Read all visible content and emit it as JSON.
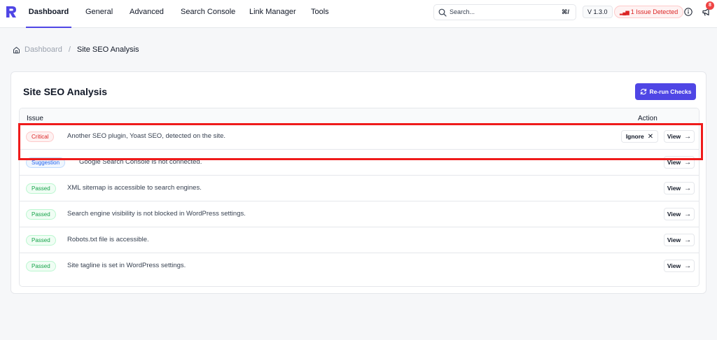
{
  "nav": {
    "tabs": [
      {
        "label": "Dashboard",
        "active": true
      },
      {
        "label": "General"
      },
      {
        "label": "Advanced"
      },
      {
        "label": "Search Console"
      },
      {
        "label": "Link Manager"
      },
      {
        "label": "Tools"
      }
    ],
    "search": {
      "placeholder": "Search...",
      "shortcut": "⌘/"
    },
    "version": "V 1.3.0",
    "issue_badge": "1 Issue Detected",
    "notification_count": "8",
    "accent_color": "#4f46e5"
  },
  "breadcrumb": {
    "home": "Dashboard",
    "separator": "/",
    "current": "Site SEO Analysis"
  },
  "card": {
    "title": "Site SEO Analysis",
    "rerun_label": "Re-run Checks",
    "columns": {
      "issue": "Issue",
      "action": "Action"
    },
    "rows": [
      {
        "status": "Critical",
        "status_type": "critical",
        "text": "Another SEO plugin, Yoast SEO, detected on the site.",
        "ignore_label": "Ignore",
        "view_label": "View"
      },
      {
        "status": "Suggestion",
        "status_type": "suggestion",
        "text": "Google Search Console is not connected.",
        "view_label": "View"
      },
      {
        "status": "Passed",
        "status_type": "passed",
        "text": "XML sitemap is accessible to search engines.",
        "view_label": "View"
      },
      {
        "status": "Passed",
        "status_type": "passed",
        "text": "Search engine visibility is not blocked in WordPress settings.",
        "view_label": "View"
      },
      {
        "status": "Passed",
        "status_type": "passed",
        "text": "Robots.txt file is accessible.",
        "view_label": "View"
      },
      {
        "status": "Passed",
        "status_type": "passed",
        "text": "Site tagline is set in WordPress settings.",
        "view_label": "View"
      }
    ]
  },
  "icons": {
    "logo": "logo-icon",
    "search": "search-icon",
    "info": "info-icon",
    "notifications": "megaphone-icon",
    "home": "home-icon",
    "rerun": "refresh-icon",
    "ignore": "close-icon",
    "view": "arrow-right-icon"
  }
}
